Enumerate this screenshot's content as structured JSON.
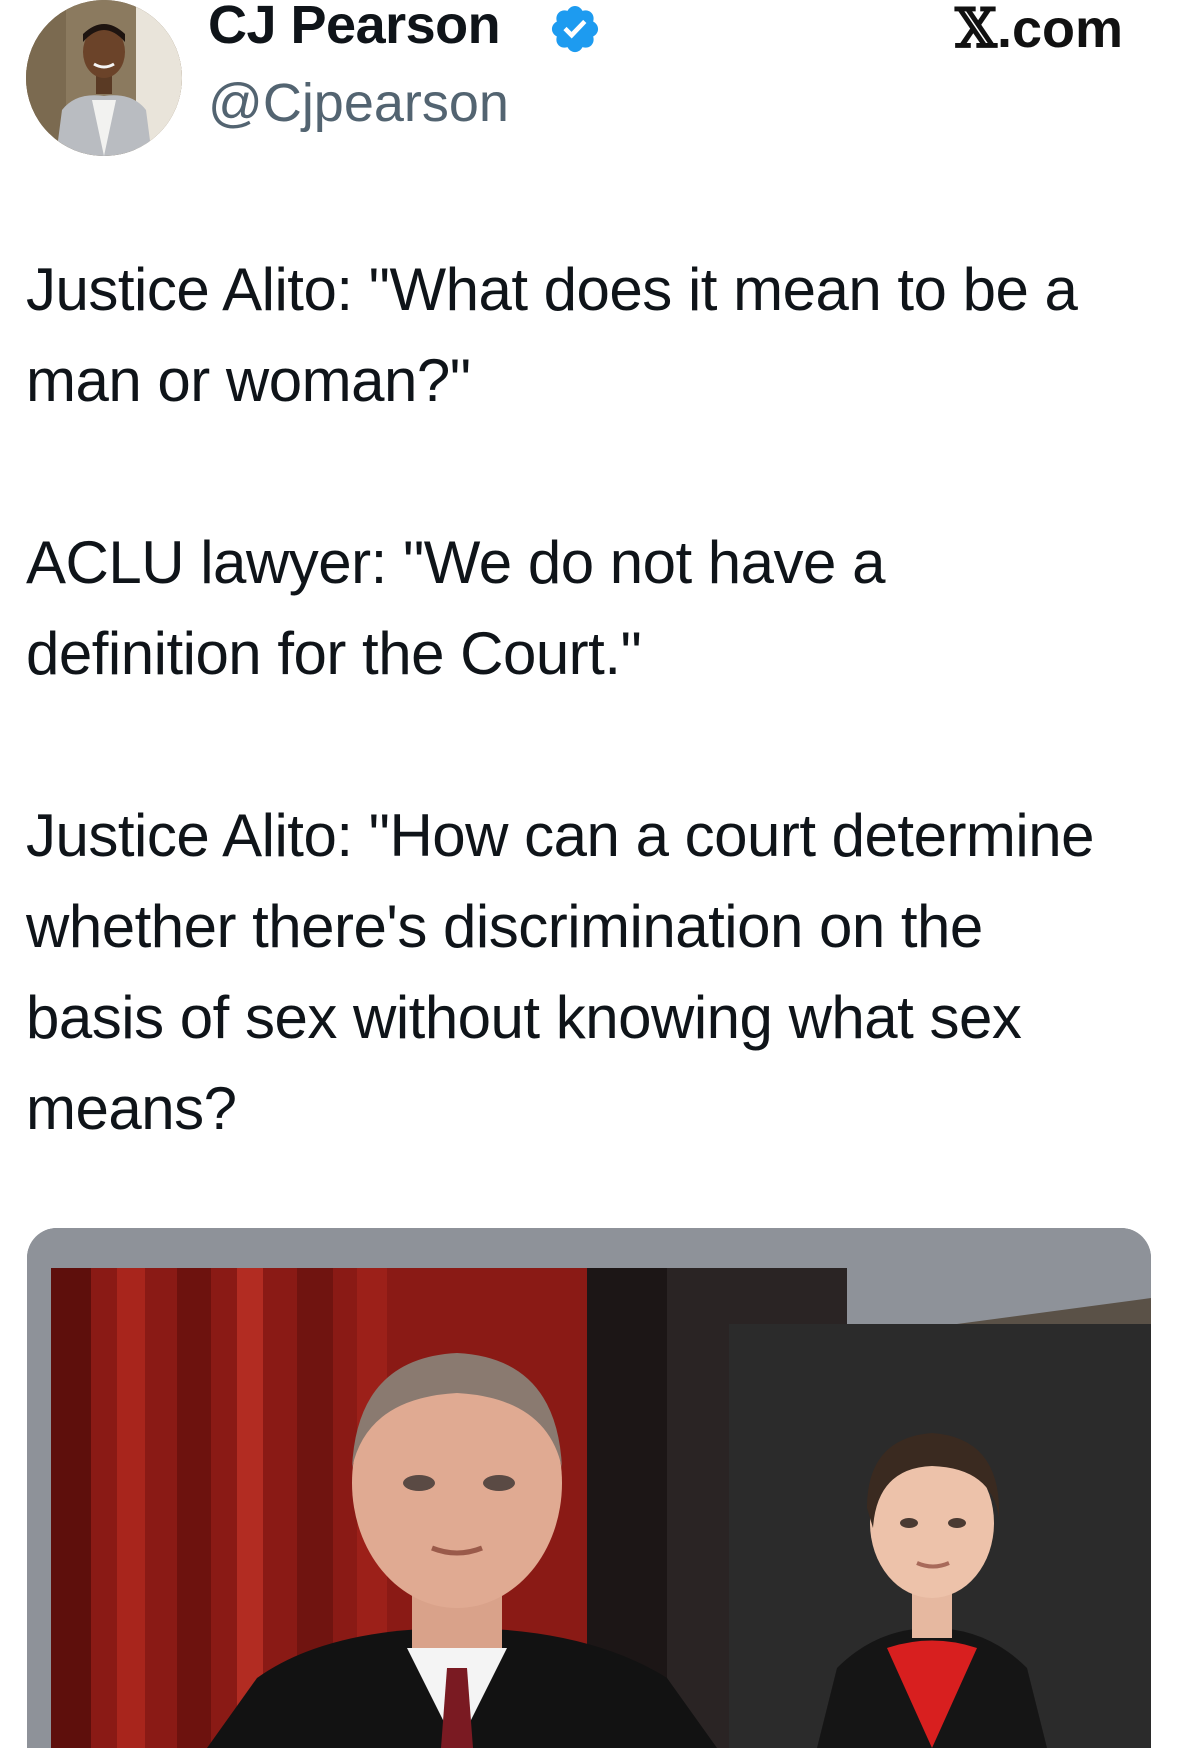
{
  "author": {
    "display_name": "CJ Pearson",
    "handle": "@Cjpearson",
    "verified": true,
    "avatar_icon": "profile-photo"
  },
  "site": {
    "label_glyph": "𝕏",
    "label_suffix": ".com"
  },
  "tweet": {
    "paragraphs": [
      "Justice Alito: \"What does it mean to be a man or woman?\"",
      "ACLU lawyer: \"We do not have a definition for the Court.\"",
      "Justice Alito: \"How can a court determine whether there's discrimination on the basis of sex without knowing what sex means?"
    ]
  },
  "colors": {
    "verified_blue": "#1d9bf0",
    "handle_gray": "#536471",
    "text": "#0f1419"
  }
}
